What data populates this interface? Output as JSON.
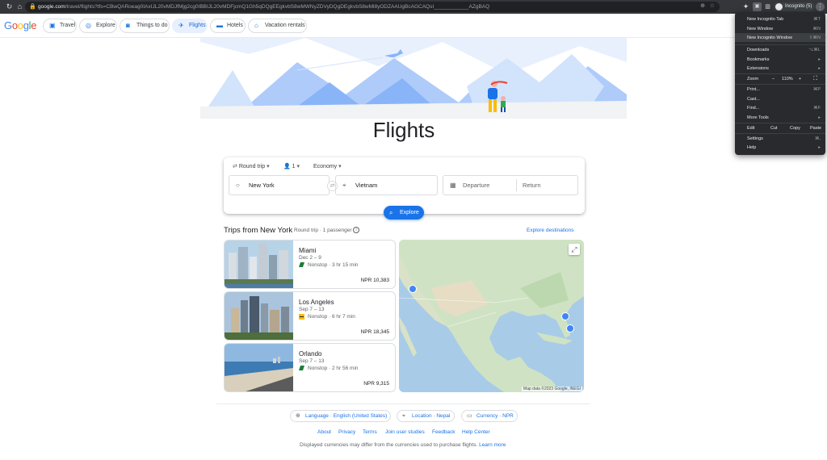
{
  "browser": {
    "url_domain": "google.com",
    "url_path": "/travel/flights?tfs=CBwQARoeag0IAxIJL20vMDJfMjg2cg0IBBIJL20vMDFjcmQ1Gh5qDQgEEgkvbS8wMWNyZDVyDQgDEgkvbS8wMl8yODZAAUgBcAGCAQsI____________AZgBAQ",
    "profile_label": "Incognito (5)"
  },
  "header": {
    "logo": "Google",
    "tabs": [
      {
        "label": "Travel",
        "icon": "suitcase-icon"
      },
      {
        "label": "Explore",
        "icon": "explore-icon"
      },
      {
        "label": "Things to do",
        "icon": "camera-icon"
      },
      {
        "label": "Flights",
        "icon": "plane-icon"
      },
      {
        "label": "Hotels",
        "icon": "bed-icon"
      },
      {
        "label": "Vacation rentals",
        "icon": "house-icon"
      }
    ]
  },
  "hero": {
    "title": "Flights"
  },
  "search": {
    "trip_type": "Round trip",
    "passengers": "1",
    "cabin": "Economy",
    "origin": "New York",
    "destination": "Vietnam",
    "departure_placeholder": "Departure",
    "return_placeholder": "Return",
    "explore_label": "Explore"
  },
  "trips": {
    "title": "Trips from New York",
    "subtitle": "Round trip · 1 passenger",
    "explore_destinations": "Explore destinations",
    "cards": [
      {
        "city": "Miami",
        "dates": "Dec 2 – 9",
        "stops": "Nonstop · 3 hr 15 min",
        "price": "NPR 10,383"
      },
      {
        "city": "Los Angeles",
        "dates": "Sep 7 – 13",
        "stops": "Nonstop · 6 hr 7 min",
        "price": "NPR 18,345"
      },
      {
        "city": "Orlando",
        "dates": "Sep 7 – 13",
        "stops": "Nonstop · 2 hr 56 min",
        "price": "NPR 9,315"
      }
    ]
  },
  "map": {
    "attribution": "Map data ©2023 Google, INEGI"
  },
  "footer": {
    "language": "Language · English (United States)",
    "location": "Location · Nepal",
    "currency": "Currency · NPR",
    "links": [
      "About",
      "Privacy",
      "Terms",
      "Join user studies",
      "Feedback",
      "Help Center"
    ],
    "disclaimer": "Displayed currencies may differ from the currencies used to purchase flights.",
    "learn_more": "Learn more"
  },
  "menu": {
    "new_tab": "New Incognito Tab",
    "new_tab_shortcut": "⌘T",
    "new_window": "New Window",
    "new_window_shortcut": "⌘N",
    "new_incognito": "New Incognito Window",
    "new_incognito_shortcut": "⇧⌘N",
    "downloads": "Downloads",
    "downloads_shortcut": "⌥⌘L",
    "bookmarks": "Bookmarks",
    "extensions": "Extensions",
    "zoom_label": "Zoom",
    "zoom_minus": "–",
    "zoom_value": "110%",
    "zoom_plus": "+",
    "print": "Print...",
    "print_shortcut": "⌘P",
    "cast": "Cast...",
    "find": "Find...",
    "find_shortcut": "⌘F",
    "more_tools": "More Tools",
    "edit": "Edit",
    "cut": "Cut",
    "copy": "Copy",
    "paste": "Paste",
    "settings": "Settings",
    "settings_shortcut": "⌘,",
    "help": "Help"
  },
  "colors": {
    "accent": "#1a73e8",
    "menu_bg": "#292a2d",
    "browser_bg": "#35363a"
  }
}
